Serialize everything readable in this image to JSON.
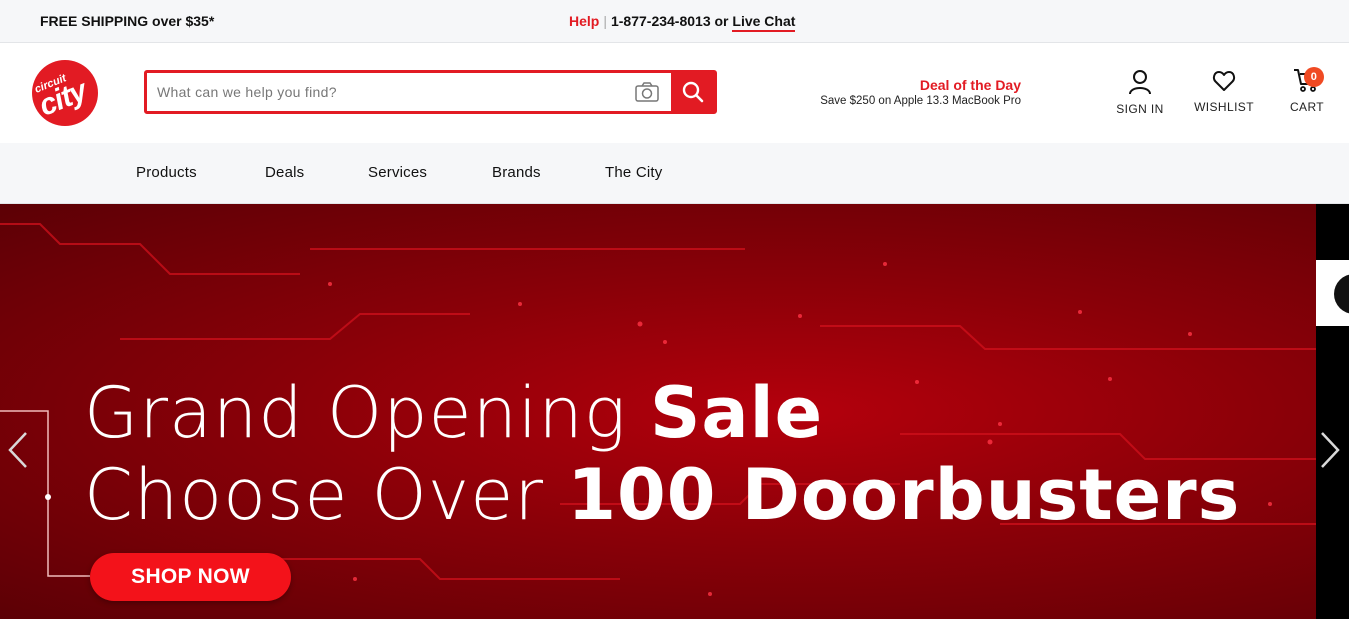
{
  "topbar": {
    "shipping": "FREE SHIPPING over $35*",
    "help_label": "Help",
    "separator": "|",
    "phone": "1-877-234-8013 or",
    "live_chat": "Live Chat"
  },
  "header": {
    "logo_small": "circuit",
    "logo_big": "city",
    "search_placeholder": "What can we help you find?",
    "deal_title": "Deal of the Day",
    "deal_subtitle": "Save $250 on Apple 13.3 MacBook Pro",
    "sign_in": "SIGN IN",
    "wishlist": "WISHLIST",
    "cart": "CART",
    "cart_count": "0"
  },
  "nav": {
    "items": [
      "Products",
      "Deals",
      "Services",
      "Brands",
      "The City"
    ]
  },
  "hero": {
    "line1_light": "Grand Opening ",
    "line1_bold": "Sale",
    "line2_light": "Choose Over ",
    "line2_bold": "100 Doorbusters",
    "cta": "SHOP NOW"
  },
  "colors": {
    "brand_red": "#e21b23",
    "cart_badge": "#f04a23",
    "topbar_bg": "#f6f7f9"
  },
  "icons": [
    "camera-icon",
    "search-icon",
    "user-icon",
    "heart-icon",
    "cart-icon",
    "chevron-left-icon",
    "chevron-right-icon"
  ]
}
